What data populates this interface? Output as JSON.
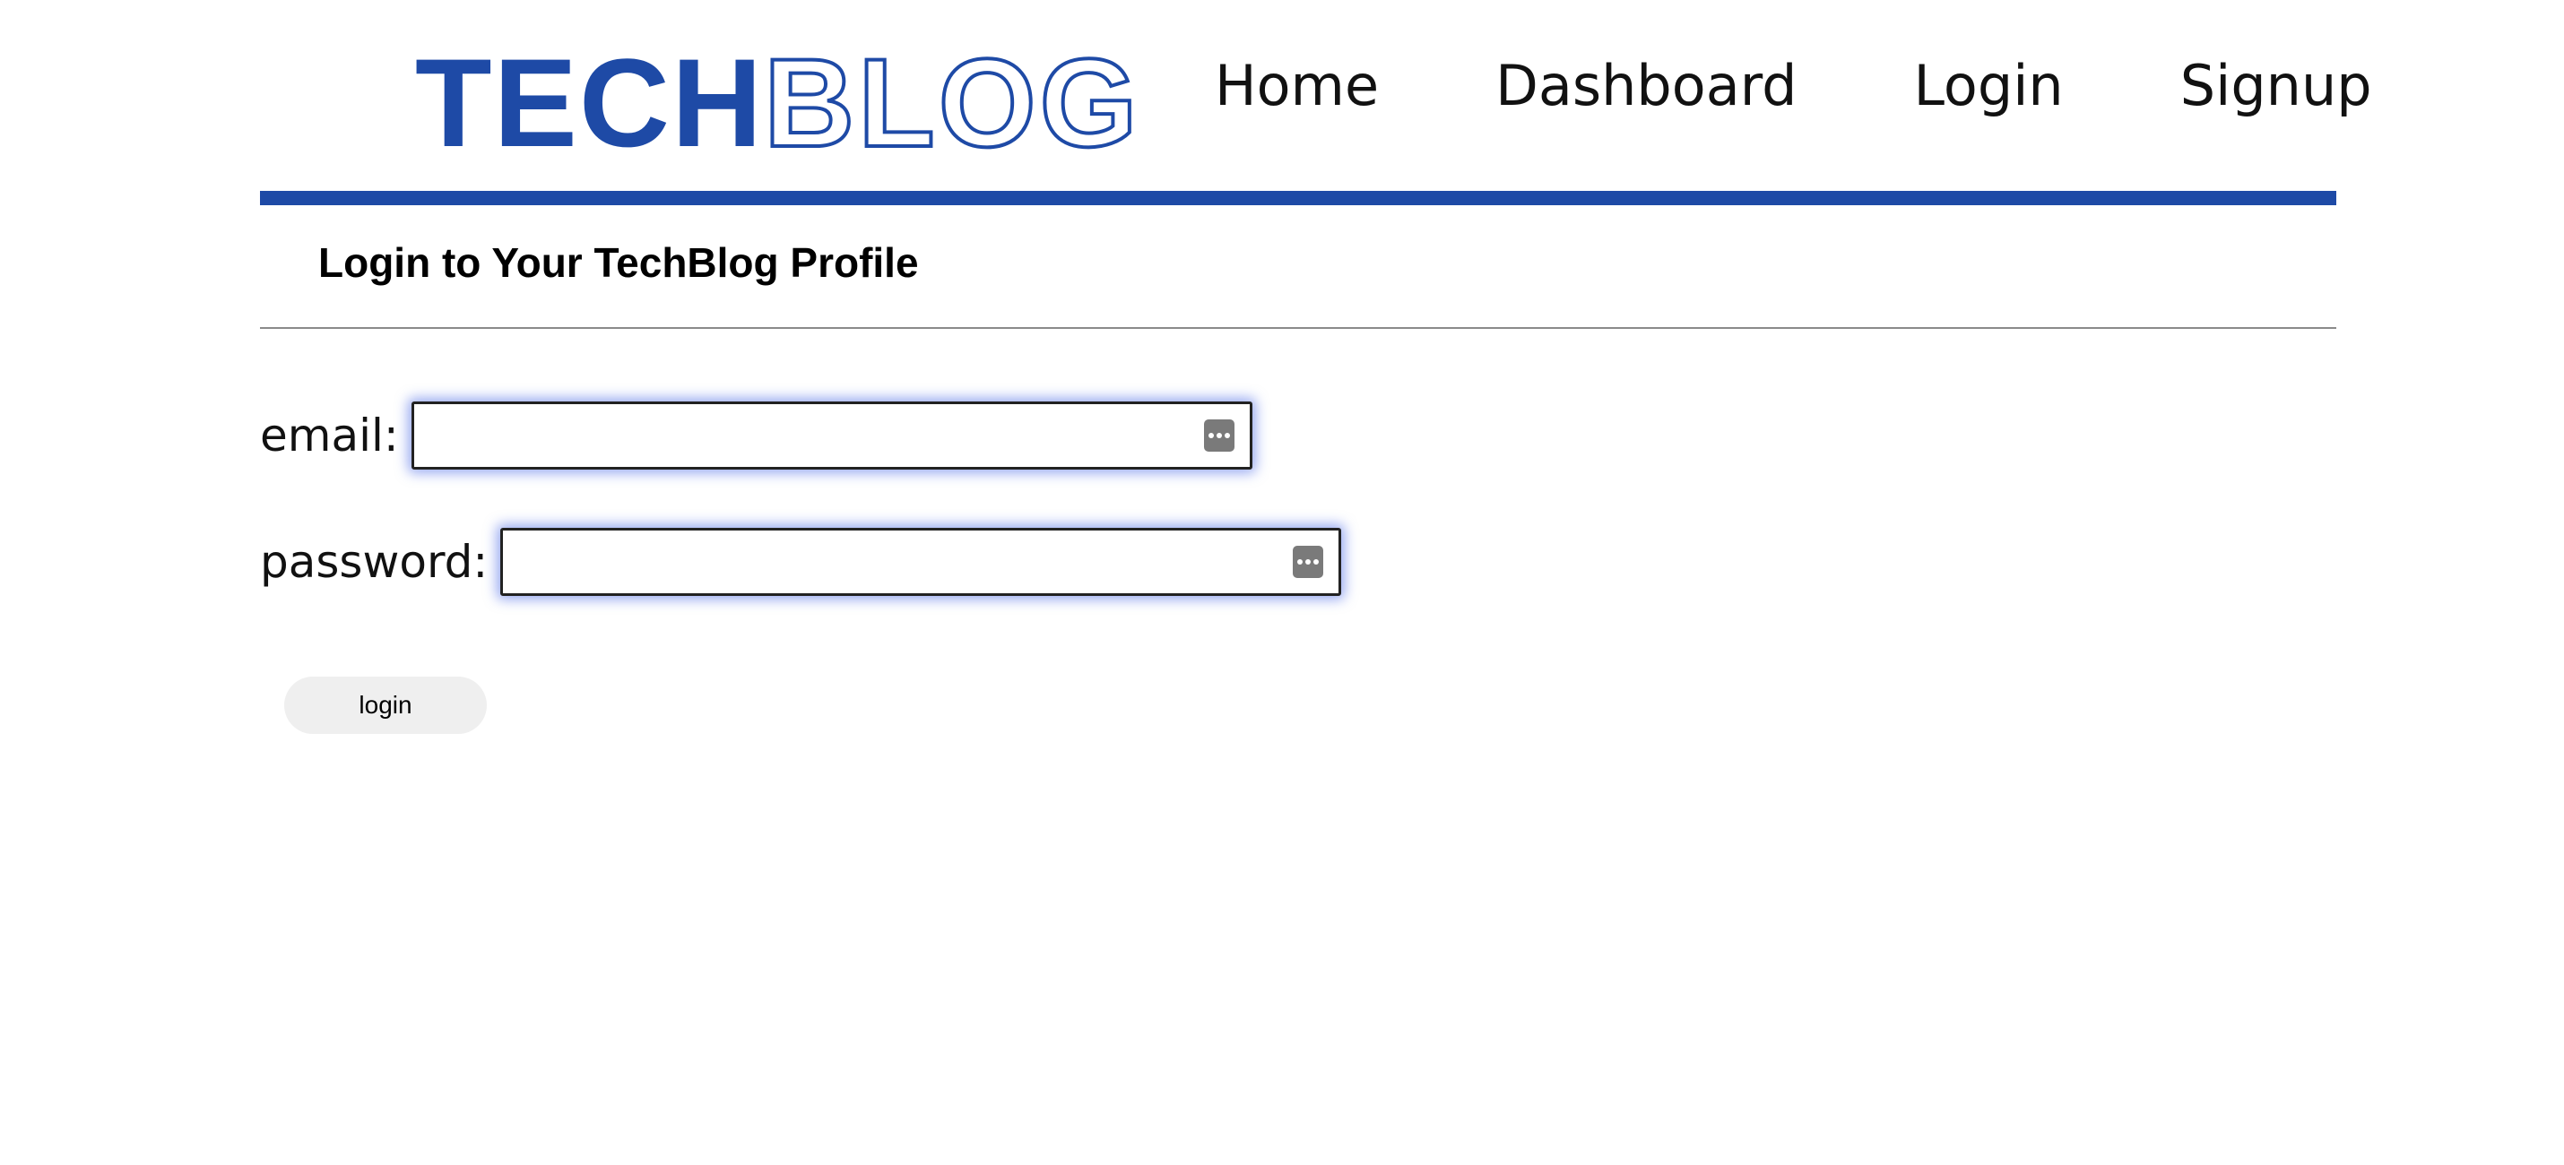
{
  "header": {
    "logo_solid": "TECH",
    "logo_outline": "BLOG",
    "nav": {
      "home": "Home",
      "dashboard": "Dashboard",
      "login": "Login",
      "signup": "Signup"
    }
  },
  "colors": {
    "brand": "#1e4aa6",
    "rule": "#8a8a8a",
    "button_bg": "#efefef"
  },
  "main": {
    "title": "Login to Your TechBlog Profile",
    "form": {
      "email_label": "email:",
      "email_value": "",
      "password_label": "password:",
      "password_value": "",
      "submit_label": "login",
      "field_icon": "password-manager-key-icon"
    }
  }
}
